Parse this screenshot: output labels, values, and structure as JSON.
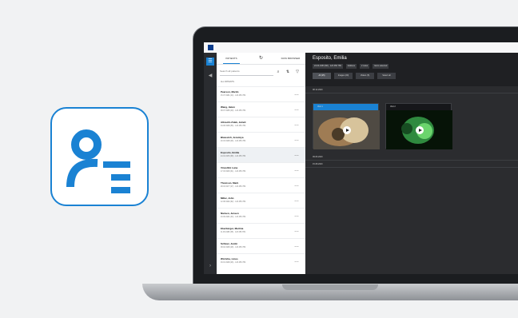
{
  "sidebar": {
    "tabs": [
      "PATIENTS",
      "DATA BROWSER"
    ],
    "search_placeholder": "Search all patients",
    "section": "ALL PATIENTS",
    "patients": [
      {
        "name": "Pearson, Martin",
        "meta": "15.07.1981 (44) · 123 456 789"
      },
      {
        "name": "Wang, Helen",
        "meta": "08.07.1985 (40) · 123 456 789"
      },
      {
        "name": "Albrecht-Zidek, Juliett",
        "meta": "04.08.1968 (56) · 123 456 789"
      },
      {
        "name": "Blazevich, Jeremiya",
        "meta": "20.03.1998 (26) · 123 456 789"
      },
      {
        "name": "Esposito, Emilia",
        "meta": "24.04.1953 (68) · 123 456 789"
      },
      {
        "name": "Vincellini Luna",
        "meta": "17.03.1993 (31) · 123 456 789"
      },
      {
        "name": "Thomson, Mark",
        "meta": "28.03.1977 (47) · 123 456 789"
      },
      {
        "name": "Miller, John",
        "meta": "12.08.1962 (62) · 123 456 789"
      },
      {
        "name": "Nielsen, Jensen",
        "meta": "23.09.1991 (33) · 123 456 789"
      },
      {
        "name": "Eberbürger, Martina",
        "meta": "11.06.1989 (35) · 123 456 789"
      },
      {
        "name": "Schleer, Justin",
        "meta": "08.02.1996 (28) · 123 456 789"
      },
      {
        "name": "Wörtche, Linus",
        "meta": "03.01.1999 (26) · 123 456 789"
      }
    ]
  },
  "main": {
    "title": "Esposito, Emilia",
    "meta": "24.04.1953 (68) · 123 456 789",
    "chips": [
      "Address",
      "2 notes",
      "Items selected"
    ],
    "filters": [
      "All (25)",
      "Images (20)",
      "Videos (5)",
      "Select all"
    ],
    "groups": [
      "08.12.2023",
      "09.06.2023",
      "15.08.2023"
    ],
    "thumb_labels": [
      "Visit 1",
      "Visit 2"
    ]
  }
}
